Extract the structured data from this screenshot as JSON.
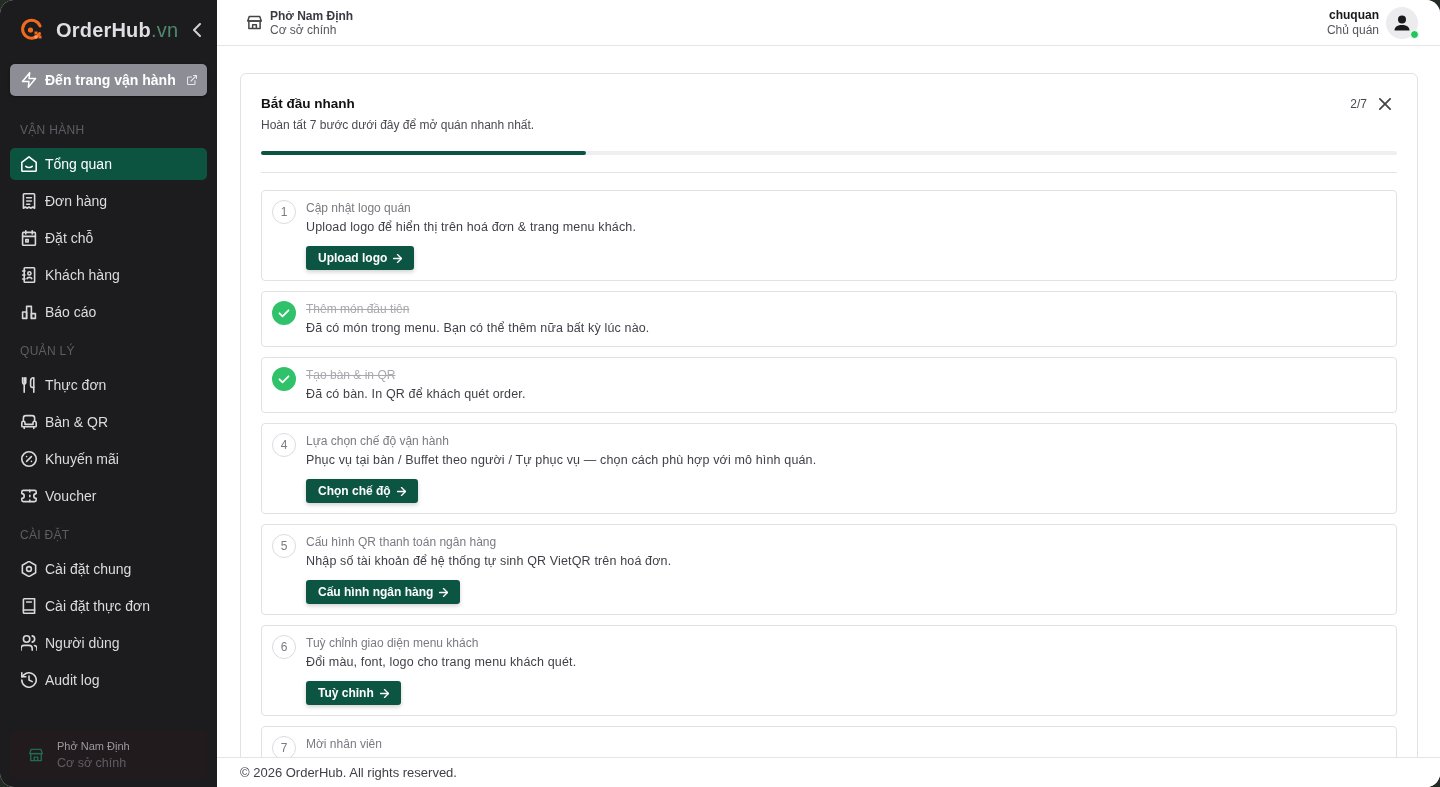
{
  "sidebar": {
    "brand": {
      "name": "OrderHub",
      "suffix": ".vn"
    },
    "operate_button": {
      "label": "Đến trang vận hành"
    },
    "sections": [
      {
        "title": "VẬN HÀNH",
        "items": [
          {
            "label": "Tổng quan",
            "selected": true
          },
          {
            "label": "Đơn hàng",
            "selected": false
          },
          {
            "label": "Đặt chỗ",
            "selected": false
          },
          {
            "label": "Khách hàng",
            "selected": false
          },
          {
            "label": "Báo cáo",
            "selected": false
          }
        ]
      },
      {
        "title": "QUẢN LÝ",
        "items": [
          {
            "label": "Thực đơn",
            "selected": false
          },
          {
            "label": "Bàn & QR",
            "selected": false
          },
          {
            "label": "Khuyến mãi",
            "selected": false
          },
          {
            "label": "Voucher",
            "selected": false
          }
        ]
      },
      {
        "title": "CÀI ĐẶT",
        "items": [
          {
            "label": "Cài đặt chung",
            "selected": false
          },
          {
            "label": "Cài đặt thực đơn",
            "selected": false
          },
          {
            "label": "Người dùng",
            "selected": false
          },
          {
            "label": "Audit log",
            "selected": false
          }
        ]
      }
    ],
    "store": {
      "name": "Phở Nam Định",
      "branch": "Cơ sở chính"
    }
  },
  "header": {
    "store": {
      "name": "Phở Nam Định",
      "branch": "Cơ sở chính"
    },
    "user": {
      "name": "chuquan",
      "role": "Chủ quán",
      "online": true
    }
  },
  "quick_start": {
    "title": "Bắt đầu nhanh",
    "subtitle": "Hoàn tất 7 bước dưới đây để mở quán nhanh nhất.",
    "counter": "2/7",
    "progress": {
      "level": 0.2857
    },
    "steps": [
      {
        "number": "1",
        "title": "Cập nhật logo quán",
        "description": "Upload logo để hiển thị trên hoá đơn & trang menu khách.",
        "action": "Upload logo",
        "done": false
      },
      {
        "title": "Thêm món đầu tiên",
        "description": "Đã có món trong menu. Bạn có thể thêm nữa bất kỳ lúc nào.",
        "done": true
      },
      {
        "title": "Tạo bàn & in QR",
        "description": "Đã có bàn. In QR để khách quét order.",
        "done": true
      },
      {
        "number": "4",
        "title": "Lựa chọn chế độ vận hành",
        "description": "Phục vụ tại bàn / Buffet theo người / Tự phục vụ — chọn cách phù hợp với mô hình quán.",
        "action": "Chọn chế độ",
        "done": false
      },
      {
        "number": "5",
        "title": "Cấu hình QR thanh toán ngân hàng",
        "description": "Nhập số tài khoản để hệ thống tự sinh QR VietQR trên hoá đơn.",
        "action": "Cấu hình ngân hàng",
        "done": false
      },
      {
        "number": "6",
        "title": "Tuỳ chỉnh giao diện menu khách",
        "description": "Đổi màu, font, logo cho trang menu khách quét.",
        "action": "Tuỳ chỉnh",
        "done": false
      },
      {
        "number": "7",
        "title": "Mời nhân viên",
        "done": false
      }
    ]
  },
  "footer": {
    "text": "© 2026 OrderHub. All rights reserved."
  }
}
